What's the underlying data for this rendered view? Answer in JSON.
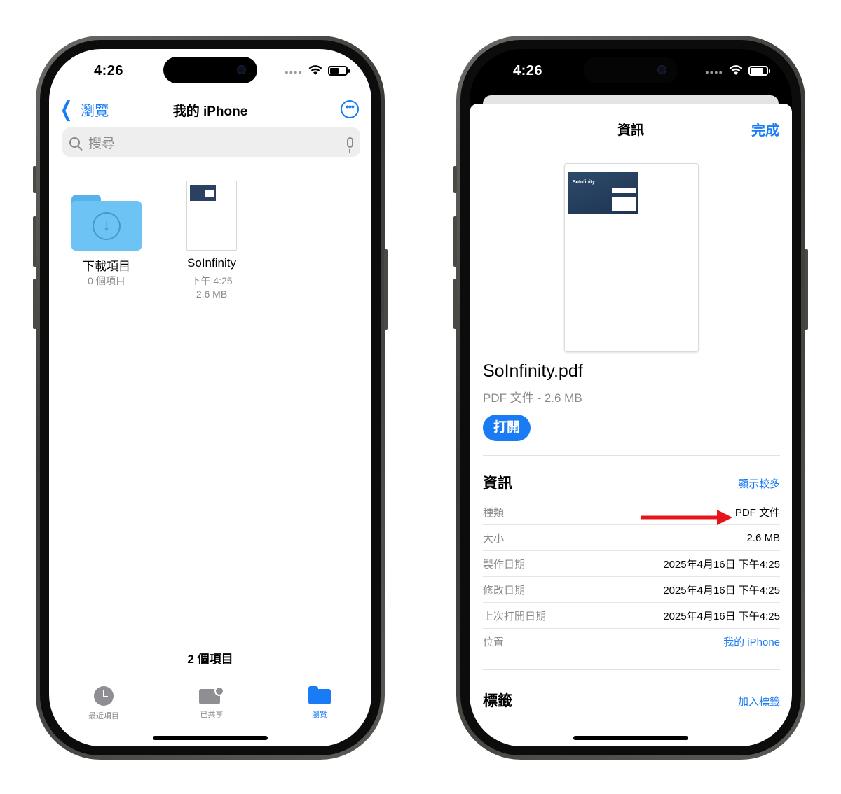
{
  "left_phone": {
    "status": {
      "time": "4:26"
    },
    "nav": {
      "back_label": "瀏覽",
      "title": "我的 iPhone",
      "more_icon": "ellipsis-circle-icon"
    },
    "search": {
      "placeholder": "搜尋"
    },
    "items": [
      {
        "name": "下載項目",
        "sub1": "0 個項目",
        "sub2": ""
      },
      {
        "name": "SoInfinity",
        "sub1": "下午 4:25",
        "sub2": "2.6 MB"
      }
    ],
    "item_count": "2 個項目",
    "tabbar": [
      {
        "label": "最近項目",
        "icon": "clock-icon",
        "active": false
      },
      {
        "label": "已共享",
        "icon": "shared-folder-icon",
        "active": false
      },
      {
        "label": "瀏覽",
        "icon": "folder-icon",
        "active": true
      }
    ]
  },
  "right_phone": {
    "status": {
      "time": "4:26"
    },
    "sheet": {
      "title": "資訊",
      "done_label": "完成"
    },
    "preview": {
      "logo_text": "SoInfinity"
    },
    "file": {
      "name": "SoInfinity.pdf",
      "meta": "PDF 文件 - 2.6 MB",
      "open_label": "打開"
    },
    "info_section": {
      "title": "資訊",
      "action": "顯示較多",
      "rows": [
        {
          "key": "種類",
          "value": "PDF 文件"
        },
        {
          "key": "大小",
          "value": "2.6 MB"
        },
        {
          "key": "製作日期",
          "value": "2025年4月16日 下午4:25"
        },
        {
          "key": "修改日期",
          "value": "2025年4月16日 下午4:25"
        },
        {
          "key": "上次打開日期",
          "value": "2025年4月16日 下午4:25"
        },
        {
          "key": "位置",
          "value": "我的 iPhone"
        }
      ]
    },
    "tags_section": {
      "title": "標籤",
      "action": "加入標籤"
    }
  },
  "colors": {
    "accent": "#1a7cf5",
    "annotation_arrow": "#e8141c",
    "folder": "#6cc3f4"
  }
}
